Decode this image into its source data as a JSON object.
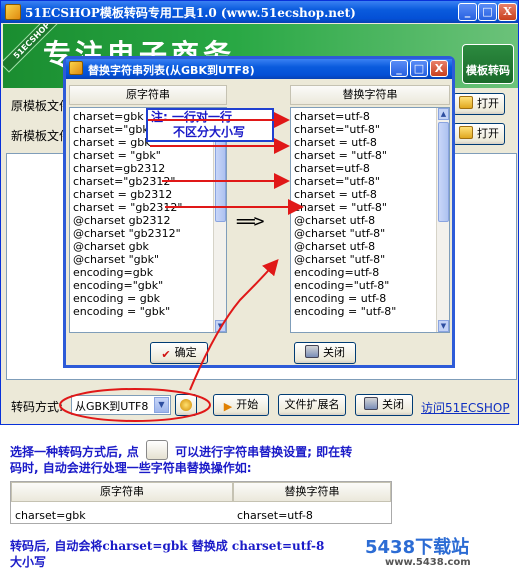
{
  "main_window": {
    "title": "51ECSHOP模板转码专用工具1.0 (www.51ecshop.net)",
    "controls": {
      "minimize": "_",
      "maximize": "□",
      "close": "X"
    },
    "banner": {
      "slogan": "专注电子商务",
      "ribbon": "51ECSHOP",
      "badge": "模板转码"
    },
    "original_template_label": "原模板文件",
    "new_template_label": "新模板文件",
    "open_button": "打开",
    "open_button2": "打开",
    "transcode_mode_label": "转码方式:",
    "transcode_mode_value": "从GBK到UTF8",
    "start_button": "开始",
    "file_ext_button": "文件扩展名",
    "close_button": "关闭",
    "visit_link": "访问51ECSHOP"
  },
  "dialog": {
    "title": "替换字符串列表(从GBK到UTF8)",
    "left_header": "原字符串",
    "right_header": "替换字符串",
    "left_items": [
      "charset=gbk",
      "charset=\"gbk\"",
      "charset = gbk",
      "charset = \"gbk\"",
      "charset=gb2312",
      "charset=\"gb2312\"",
      "charset = gb2312",
      "charset = \"gb2312\"",
      "@charset gb2312",
      "@charset \"gb2312\"",
      "@charset gbk",
      "@charset \"gbk\"",
      "encoding=gbk",
      "encoding=\"gbk\"",
      "encoding = gbk",
      "encoding = \"gbk\""
    ],
    "right_items": [
      "charset=utf-8",
      "charset=\"utf-8\"",
      "charset = utf-8",
      "charset = \"utf-8\"",
      "charset=utf-8",
      "charset=\"utf-8\"",
      "charset = utf-8",
      "charset = \"utf-8\"",
      "@charset utf-8",
      "@charset \"utf-8\"",
      "@charset utf-8",
      "@charset \"utf-8\"",
      "encoding=utf-8",
      "encoding=\"utf-8\"",
      "encoding = utf-8",
      "encoding = \"utf-8\""
    ],
    "mid_arrow": "==>",
    "ok_button": "确定",
    "close_button": "关闭",
    "controls": {
      "minimize": "_",
      "maximize": "□",
      "close": "X"
    }
  },
  "annotation": {
    "line1": "注: 一行对一行",
    "line2": "不区分大小写"
  },
  "explanation": {
    "line1a": "选择一种转码方式后, 点",
    "line1b": "可以进行字符串替换设置; 即在转",
    "line2": "码时, 自动会进行处理一些字符串替换操作如:",
    "table_left_header": "原字符串",
    "table_right_header": "替换字符串",
    "table_left_value": "charset=gbk",
    "table_right_value": "charset=utf-8",
    "footer_line1": "转码后, 自动会将charset=gbk 替换成 charset=utf-8",
    "footer_line2": "大小写"
  },
  "watermark": {
    "logo": "5438下载站",
    "url": "www.5438.com"
  },
  "colors": {
    "annotation_blue": "#1a1ac8",
    "arrow_red": "#e01818",
    "xp_title_blue": "#0a5bdd"
  }
}
